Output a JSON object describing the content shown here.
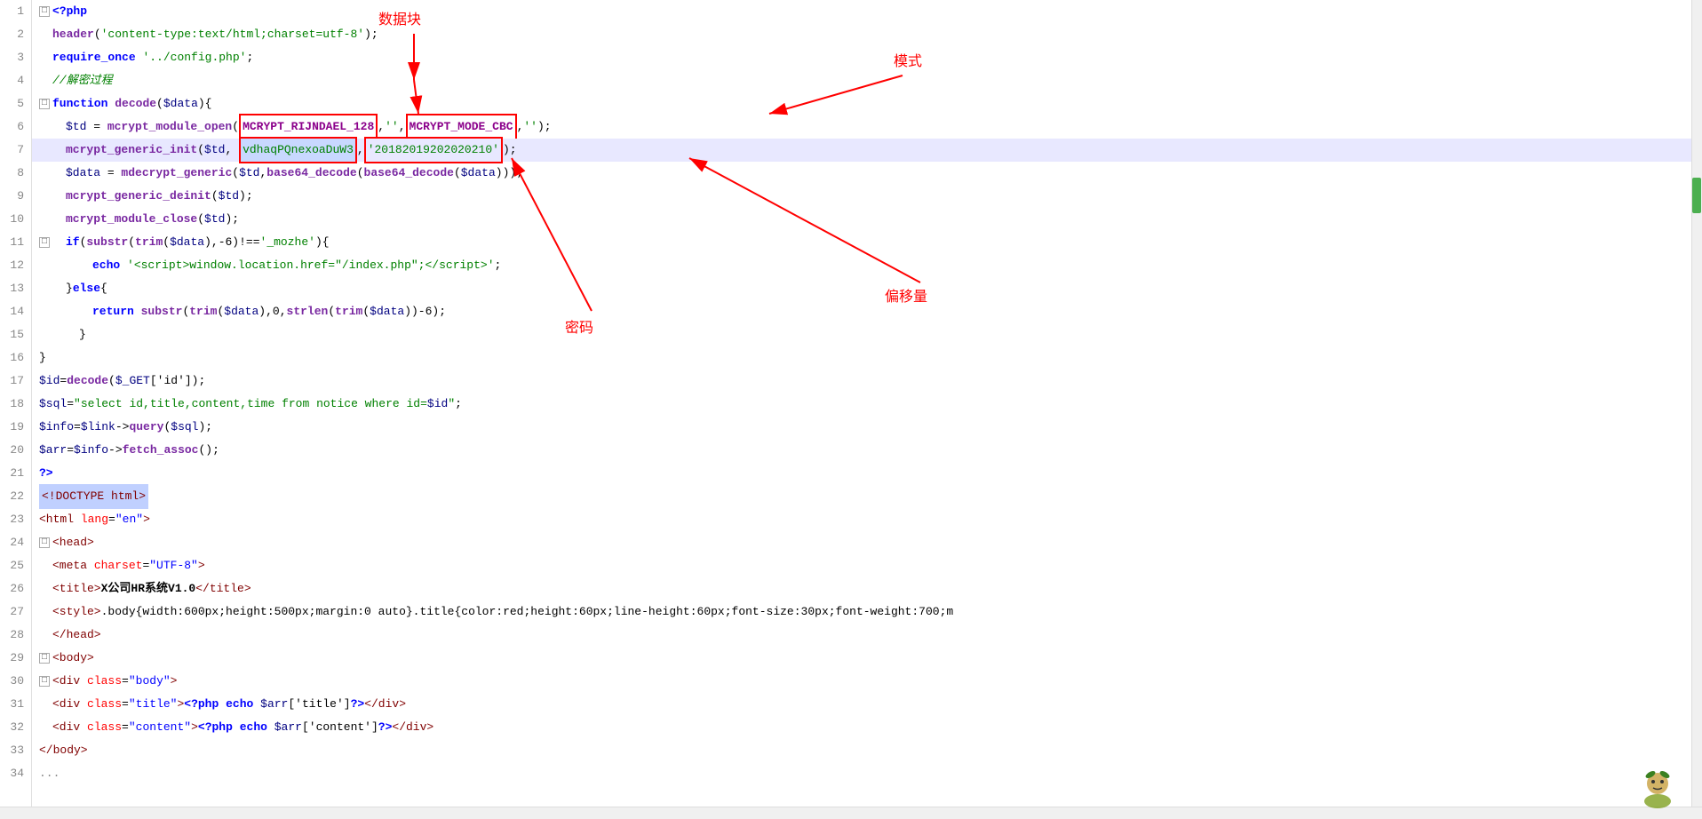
{
  "editor": {
    "lines": [
      {
        "num": 1,
        "fold": "□",
        "content": "php_open",
        "highlighted": false
      },
      {
        "num": 2,
        "fold": null,
        "content": "header_line",
        "highlighted": false
      },
      {
        "num": 3,
        "fold": null,
        "content": "require_line",
        "highlighted": false
      },
      {
        "num": 4,
        "fold": null,
        "content": "comment_line",
        "highlighted": false
      },
      {
        "num": 5,
        "fold": "□",
        "content": "function_line",
        "highlighted": false
      },
      {
        "num": 6,
        "fold": null,
        "content": "td_line",
        "highlighted": false
      },
      {
        "num": 7,
        "fold": null,
        "content": "init_line",
        "highlighted": true
      },
      {
        "num": 8,
        "fold": null,
        "content": "data_line",
        "highlighted": false
      },
      {
        "num": 9,
        "fold": null,
        "content": "deinit_line",
        "highlighted": false
      },
      {
        "num": 10,
        "fold": null,
        "content": "close_line",
        "highlighted": false
      },
      {
        "num": 11,
        "fold": "□",
        "content": "if_line",
        "highlighted": false
      },
      {
        "num": 12,
        "fold": null,
        "content": "echo_line",
        "highlighted": false
      },
      {
        "num": 13,
        "fold": null,
        "content": "else_line",
        "highlighted": false
      },
      {
        "num": 14,
        "fold": null,
        "content": "return_line",
        "highlighted": false
      },
      {
        "num": 15,
        "fold": null,
        "content": "close_brace1",
        "highlighted": false
      },
      {
        "num": 16,
        "fold": null,
        "content": "close_brace2",
        "highlighted": false
      },
      {
        "num": 17,
        "fold": null,
        "content": "id_line",
        "highlighted": false
      },
      {
        "num": 18,
        "fold": null,
        "content": "sql_line",
        "highlighted": false
      },
      {
        "num": 19,
        "fold": null,
        "content": "info_line",
        "highlighted": false
      },
      {
        "num": 20,
        "fold": null,
        "content": "arr_line",
        "highlighted": false
      },
      {
        "num": 21,
        "fold": null,
        "content": "php_close",
        "highlighted": false
      },
      {
        "num": 22,
        "fold": null,
        "content": "doctype_line",
        "highlighted": false
      },
      {
        "num": 23,
        "fold": null,
        "content": "html_open",
        "highlighted": false
      },
      {
        "num": 24,
        "fold": "□",
        "content": "head_open",
        "highlighted": false
      },
      {
        "num": 25,
        "fold": null,
        "content": "meta_line",
        "highlighted": false
      },
      {
        "num": 26,
        "fold": null,
        "content": "title_line",
        "highlighted": false
      },
      {
        "num": 27,
        "fold": null,
        "content": "style_line",
        "highlighted": false
      },
      {
        "num": 28,
        "fold": null,
        "content": "head_close",
        "highlighted": false
      },
      {
        "num": 29,
        "fold": "□",
        "content": "body_open",
        "highlighted": false
      },
      {
        "num": 30,
        "fold": "□",
        "content": "div_body",
        "highlighted": false
      },
      {
        "num": 31,
        "fold": null,
        "content": "div_title",
        "highlighted": false
      },
      {
        "num": 32,
        "fold": null,
        "content": "div_content",
        "highlighted": false
      },
      {
        "num": 33,
        "fold": null,
        "content": "body_close",
        "highlighted": false
      },
      {
        "num": 34,
        "fold": null,
        "content": "ellipsis",
        "highlighted": false
      }
    ],
    "annotations": {
      "shujukuai": "数据块",
      "moshi": "模式",
      "mima": "密码",
      "pianyi": "偏移量"
    }
  }
}
